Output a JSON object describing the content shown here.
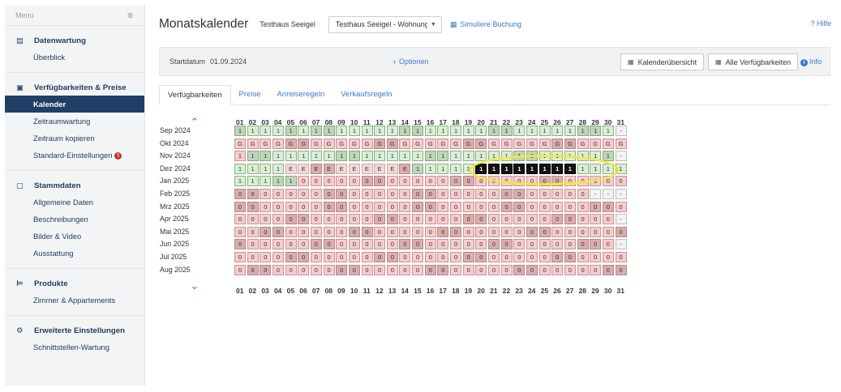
{
  "sidebar": {
    "menu_label": "Menu",
    "sections": [
      {
        "title": "Datenwartung",
        "icon": "document-icon",
        "items": [
          {
            "label": "Überblick"
          }
        ]
      },
      {
        "title": "Verfügbarkeiten & Preise",
        "icon": "list-icon",
        "items": [
          {
            "label": "Kalender",
            "active": true
          },
          {
            "label": "Zeitraumwartung"
          },
          {
            "label": "Zeitraum kopieren"
          },
          {
            "label": "Standard-Einstellungen",
            "warning": "!"
          }
        ]
      },
      {
        "title": "Stammdaten",
        "icon": "window-icon",
        "items": [
          {
            "label": "Allgemeine Daten"
          },
          {
            "label": "Beschreibungen"
          },
          {
            "label": "Bilder & Video"
          },
          {
            "label": "Ausstattung"
          }
        ]
      },
      {
        "title": "Produkte",
        "icon": "bed-icon",
        "items": [
          {
            "label": "Zimmer & Appartements"
          }
        ]
      },
      {
        "title": "Erweiterte Einstellungen",
        "icon": "gears-icon",
        "items": [
          {
            "label": "Schnittstellen-Wartung"
          }
        ]
      }
    ]
  },
  "header": {
    "title": "Monatskalender",
    "property": "Testhaus Seeigel",
    "unit_select": "Testhaus Seeigel - Wohnung",
    "simulate": "Simuliere Buchung",
    "help": "? Hilfe"
  },
  "toolbar": {
    "start_label": "Startdatum",
    "start_value": "01.09.2024",
    "options": "Optionen",
    "calendar_overview": "Kalenderübersicht",
    "all_availabilities": "Alle Verfügbarkeiten",
    "info": "Info"
  },
  "tabs": [
    "Verfügbarkeiten",
    "Preise",
    "Anreiseregeln",
    "Verkaufsregeln"
  ],
  "calendar": {
    "days": [
      "01",
      "02",
      "03",
      "04",
      "05",
      "06",
      "07",
      "08",
      "09",
      "10",
      "11",
      "12",
      "13",
      "14",
      "15",
      "16",
      "17",
      "18",
      "19",
      "20",
      "21",
      "22",
      "23",
      "24",
      "25",
      "26",
      "27",
      "28",
      "29",
      "30",
      "31"
    ],
    "rows": [
      {
        "month": "Sep 2024",
        "cells": [
          "1",
          "1",
          "1",
          "1",
          "1",
          "1",
          "1",
          "1",
          "1",
          "1",
          "1",
          "1",
          "1",
          "1",
          "1",
          "1",
          "1",
          "1",
          "1",
          "1",
          "1",
          "1",
          "1",
          "1",
          "1",
          "1",
          "1",
          "1",
          "1",
          "1",
          "-"
        ],
        "status": [
          "gd",
          "g",
          "g",
          "g",
          "gd",
          "g",
          "gd",
          "gd",
          "g",
          "g",
          "g",
          "g",
          "g",
          "gd",
          "gd",
          "g",
          "g",
          "g",
          "g",
          "g",
          "gd",
          "gd",
          "g",
          "g",
          "g",
          "g",
          "g",
          "gd",
          "gd",
          "g",
          "x"
        ]
      },
      {
        "month": "Okt 2024",
        "cells": [
          "G",
          "G",
          "G",
          "G",
          "G",
          "G",
          "G",
          "G",
          "G",
          "G",
          "G",
          "G",
          "G",
          "G",
          "G",
          "G",
          "G",
          "G",
          "G",
          "G",
          "G",
          "G",
          "G",
          "G",
          "G",
          "G",
          "G",
          "G",
          "G",
          "G",
          "G"
        ],
        "status": [
          "r",
          "r",
          "r",
          "r",
          "rd",
          "rd",
          "r",
          "r",
          "r",
          "r",
          "r",
          "rd",
          "rd",
          "r",
          "r",
          "r",
          "r",
          "r",
          "rd",
          "rd",
          "r",
          "r",
          "r",
          "r",
          "r",
          "rd",
          "rd",
          "r",
          "r",
          "r",
          "r"
        ]
      },
      {
        "month": "Nov 2024",
        "cells": [
          "1",
          "1",
          "1",
          "1",
          "1",
          "1",
          "1",
          "1",
          "1",
          "1",
          "1",
          "1",
          "1",
          "1",
          "1",
          "1",
          "1",
          "1",
          "1",
          "1",
          "1",
          "1",
          "1",
          "1",
          "1",
          "1",
          "1",
          "1",
          "1",
          "1",
          "-"
        ],
        "status": [
          "r",
          "gd",
          "gd",
          "g",
          "g",
          "g",
          "g",
          "g",
          "gd",
          "gd",
          "g",
          "g",
          "g",
          "g",
          "g",
          "gd",
          "gd",
          "g",
          "g",
          "g",
          "g",
          "g",
          "gd",
          "gd",
          "g",
          "g",
          "g",
          "g",
          "g",
          "gd",
          "x"
        ]
      },
      {
        "month": "Dez 2024",
        "cells": [
          "1",
          "1",
          "1",
          "1",
          "E",
          "E",
          "E",
          "E",
          "E",
          "E",
          "E",
          "E",
          "E",
          "E",
          "1",
          "1",
          "1",
          "1",
          "1",
          "1",
          "1",
          "1",
          "1",
          "1",
          "1",
          "1",
          "1",
          "1",
          "1",
          "1",
          "1"
        ],
        "status": [
          "g",
          "g",
          "g",
          "g",
          "p",
          "p",
          "pd",
          "pd",
          "p",
          "p",
          "p",
          "p",
          "p",
          "pd",
          "gd",
          "g",
          "g",
          "g",
          "g",
          "b",
          "b",
          "b",
          "b",
          "b",
          "b",
          "b",
          "b",
          "g",
          "g",
          "g",
          "g"
        ]
      },
      {
        "month": "Jan 2025",
        "cells": [
          "1",
          "1",
          "1",
          "1",
          "1",
          "0",
          "0",
          "0",
          "0",
          "0",
          "0",
          "0",
          "0",
          "0",
          "0",
          "0",
          "0",
          "0",
          "0",
          "0",
          "0",
          "0",
          "0",
          "0",
          "0",
          "0",
          "0",
          "0",
          "0",
          "0",
          "0"
        ],
        "status": [
          "g",
          "g",
          "g",
          "gd",
          "gd",
          "r",
          "r",
          "r",
          "r",
          "r",
          "rd",
          "rd",
          "r",
          "r",
          "r",
          "r",
          "r",
          "rd",
          "rd",
          "r",
          "r",
          "r",
          "r",
          "r",
          "rd",
          "rd",
          "r",
          "r",
          "r",
          "r",
          "r"
        ]
      },
      {
        "month": "Feb 2025",
        "cells": [
          "0",
          "0",
          "0",
          "0",
          "0",
          "0",
          "0",
          "0",
          "0",
          "0",
          "0",
          "0",
          "0",
          "0",
          "0",
          "0",
          "0",
          "0",
          "0",
          "0",
          "0",
          "0",
          "0",
          "0",
          "0",
          "0",
          "0",
          "0",
          "-",
          "-",
          "-"
        ],
        "status": [
          "rd",
          "rd",
          "r",
          "r",
          "r",
          "r",
          "r",
          "rd",
          "rd",
          "r",
          "r",
          "r",
          "r",
          "r",
          "rd",
          "rd",
          "r",
          "r",
          "r",
          "r",
          "r",
          "rd",
          "rd",
          "r",
          "r",
          "r",
          "r",
          "r",
          "x",
          "x",
          "x"
        ]
      },
      {
        "month": "Mrz 2025",
        "cells": [
          "0",
          "0",
          "0",
          "0",
          "0",
          "0",
          "0",
          "0",
          "0",
          "0",
          "0",
          "0",
          "0",
          "0",
          "0",
          "0",
          "0",
          "0",
          "0",
          "0",
          "0",
          "0",
          "0",
          "0",
          "0",
          "0",
          "0",
          "0",
          "0",
          "0",
          "0"
        ],
        "status": [
          "rd",
          "rd",
          "r",
          "r",
          "r",
          "r",
          "r",
          "rd",
          "rd",
          "r",
          "r",
          "r",
          "r",
          "r",
          "rd",
          "rd",
          "r",
          "r",
          "r",
          "r",
          "r",
          "rd",
          "rd",
          "r",
          "r",
          "r",
          "r",
          "r",
          "rd",
          "rd",
          "r"
        ]
      },
      {
        "month": "Apr 2025",
        "cells": [
          "0",
          "0",
          "0",
          "0",
          "0",
          "0",
          "0",
          "0",
          "0",
          "0",
          "0",
          "0",
          "0",
          "0",
          "0",
          "0",
          "0",
          "0",
          "0",
          "0",
          "0",
          "0",
          "0",
          "0",
          "0",
          "0",
          "0",
          "0",
          "0",
          "0",
          "-"
        ],
        "status": [
          "r",
          "r",
          "r",
          "r",
          "rd",
          "rd",
          "r",
          "r",
          "r",
          "r",
          "r",
          "rd",
          "rd",
          "r",
          "r",
          "r",
          "r",
          "r",
          "rd",
          "rd",
          "r",
          "r",
          "r",
          "r",
          "r",
          "rd",
          "rd",
          "r",
          "r",
          "r",
          "x"
        ]
      },
      {
        "month": "Mai 2025",
        "cells": [
          "0",
          "0",
          "0",
          "0",
          "0",
          "0",
          "0",
          "0",
          "0",
          "0",
          "0",
          "0",
          "0",
          "0",
          "0",
          "0",
          "0",
          "0",
          "0",
          "0",
          "0",
          "0",
          "0",
          "0",
          "0",
          "0",
          "0",
          "0",
          "0",
          "0",
          "0"
        ],
        "status": [
          "r",
          "r",
          "rd",
          "rd",
          "r",
          "r",
          "r",
          "r",
          "r",
          "rd",
          "rd",
          "r",
          "r",
          "r",
          "r",
          "r",
          "rd",
          "rd",
          "r",
          "r",
          "r",
          "r",
          "r",
          "rd",
          "rd",
          "r",
          "r",
          "r",
          "r",
          "r",
          "rd"
        ]
      },
      {
        "month": "Jun 2025",
        "cells": [
          "0",
          "0",
          "0",
          "0",
          "0",
          "0",
          "0",
          "0",
          "0",
          "0",
          "0",
          "0",
          "0",
          "0",
          "0",
          "0",
          "0",
          "0",
          "0",
          "0",
          "0",
          "0",
          "0",
          "0",
          "0",
          "0",
          "0",
          "0",
          "0",
          "0",
          "-"
        ],
        "status": [
          "rd",
          "r",
          "r",
          "r",
          "r",
          "r",
          "rd",
          "rd",
          "r",
          "r",
          "r",
          "r",
          "r",
          "rd",
          "rd",
          "r",
          "r",
          "r",
          "r",
          "r",
          "rd",
          "rd",
          "r",
          "r",
          "r",
          "r",
          "r",
          "rd",
          "rd",
          "r",
          "x"
        ]
      },
      {
        "month": "Jul 2025",
        "cells": [
          "0",
          "0",
          "0",
          "0",
          "0",
          "0",
          "0",
          "0",
          "0",
          "0",
          "0",
          "0",
          "0",
          "0",
          "0",
          "0",
          "0",
          "0",
          "0",
          "0",
          "0",
          "0",
          "0",
          "0",
          "0",
          "0",
          "0",
          "0",
          "0",
          "0",
          "0"
        ],
        "status": [
          "r",
          "r",
          "r",
          "r",
          "rd",
          "rd",
          "r",
          "r",
          "r",
          "r",
          "r",
          "rd",
          "rd",
          "r",
          "r",
          "r",
          "r",
          "r",
          "rd",
          "rd",
          "r",
          "r",
          "r",
          "r",
          "r",
          "rd",
          "rd",
          "r",
          "r",
          "r",
          "r"
        ]
      },
      {
        "month": "Aug 2025",
        "cells": [
          "0",
          "0",
          "0",
          "0",
          "0",
          "0",
          "0",
          "0",
          "0",
          "0",
          "0",
          "0",
          "0",
          "0",
          "0",
          "0",
          "0",
          "0",
          "0",
          "0",
          "0",
          "0",
          "0",
          "0",
          "0",
          "0",
          "0",
          "0",
          "0",
          "0",
          "0"
        ],
        "status": [
          "r",
          "rd",
          "rd",
          "r",
          "r",
          "r",
          "r",
          "r",
          "rd",
          "rd",
          "r",
          "r",
          "r",
          "r",
          "r",
          "rd",
          "rd",
          "r",
          "r",
          "r",
          "r",
          "r",
          "rd",
          "rd",
          "r",
          "r",
          "r",
          "r",
          "r",
          "rd",
          "rd"
        ]
      }
    ]
  },
  "icons": {
    "up": "chevron-up-icon",
    "down": "chevron-down-icon"
  }
}
